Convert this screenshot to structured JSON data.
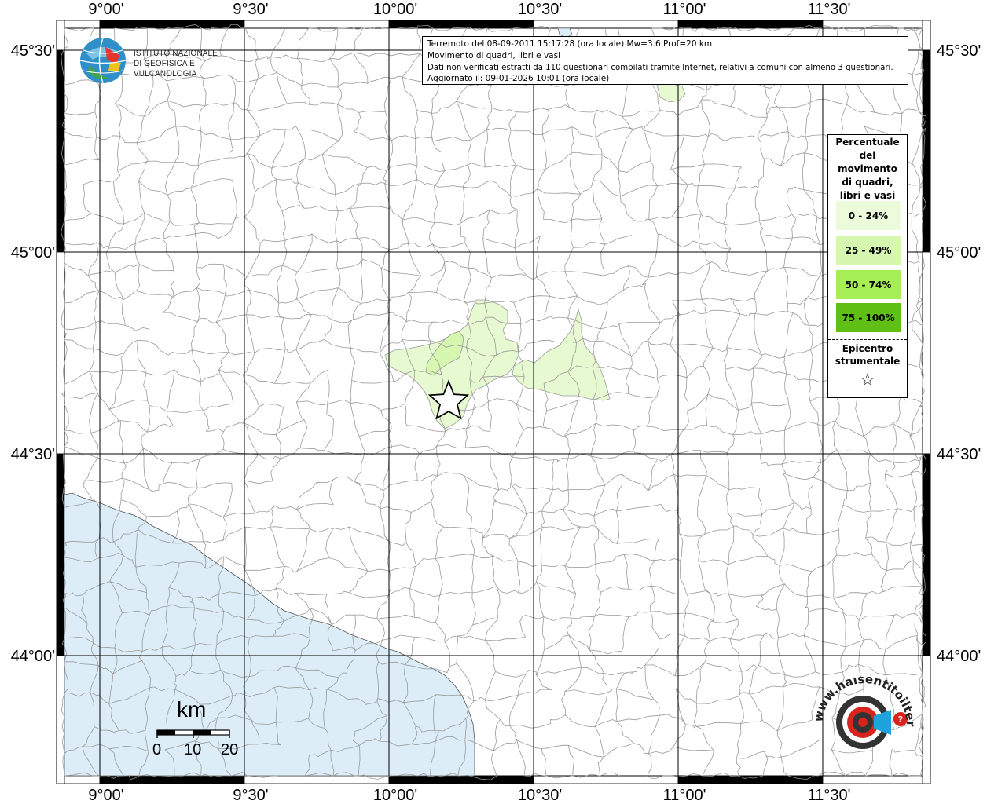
{
  "map": {
    "top_x_labels": [
      "9°00'",
      "9°30'",
      "10°00'",
      "10°30'",
      "11°00'",
      "11°30'"
    ],
    "bottom_x_labels": [
      "9°00'",
      "9°30'",
      "10°00'",
      "10°30'",
      "11°00'",
      "11°30'"
    ],
    "left_y_labels": [
      "45°30'",
      "45°00'",
      "44°30'",
      "44°00'"
    ],
    "right_y_labels": [
      "45°30'",
      "45°00'",
      "44°30'",
      "44°00'"
    ],
    "sea_color": "#dcedf8",
    "land_color": "#ffffff",
    "highlight_color": "#e6f9d0",
    "epicenter_symbol": "star-icon"
  },
  "info": {
    "line1": "Terremoto del 08-09-2011 15:17:28 (ora locale) Mw=3.6 Prof=20 km",
    "line2": "Movimento di quadri, libri e vasi",
    "line3": "Dati non verificati estratti da 110 questionari compilati tramite Internet, relativi a comuni con almeno 3 questionari.",
    "line4": "Aggiornato il: 09-01-2026 10:01 (ora locale)"
  },
  "legend": {
    "title_lines": [
      "Percentuale",
      "del",
      "movimento",
      "di quadri,",
      "libri e vasi"
    ],
    "items": [
      {
        "label": "0 - 24%",
        "color": "#ecfbdc"
      },
      {
        "label": "25 - 49%",
        "color": "#d5f7b0"
      },
      {
        "label": "50 - 74%",
        "color": "#a6ee55"
      },
      {
        "label": "75 - 100%",
        "color": "#5fbf14"
      }
    ],
    "epicenter_lines": [
      "Epicentro",
      "strumentale"
    ],
    "epicenter_symbol": "☆"
  },
  "logo_ingv": {
    "line1": "ISTITUTO NAZIONALE",
    "line2": "DI GEOFISICA E VULCANOLOGIA"
  },
  "scalebar": {
    "unit": "km",
    "ticks": [
      "0",
      "10",
      "20"
    ]
  },
  "logo_hsi": {
    "text": "www.haisentitoilterremoto.it"
  }
}
